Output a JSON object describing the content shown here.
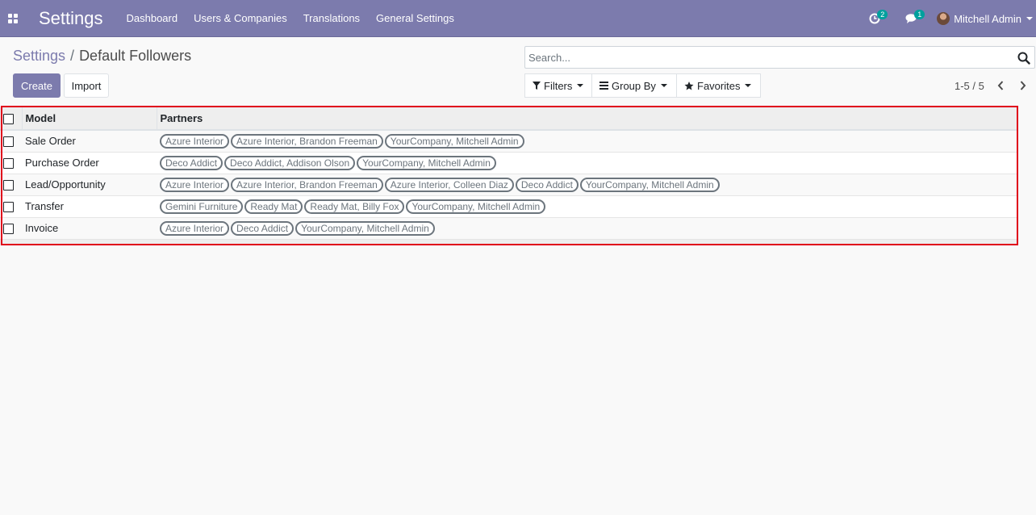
{
  "navbar": {
    "app_title": "Settings",
    "menu": [
      "Dashboard",
      "Users & Companies",
      "Translations",
      "General Settings"
    ],
    "activity_count": "2",
    "messages_count": "1",
    "user_name": "Mitchell Admin"
  },
  "breadcrumb": {
    "parent": "Settings",
    "separator": "/",
    "current": "Default Followers"
  },
  "buttons": {
    "create": "Create",
    "import": "Import"
  },
  "search": {
    "placeholder": "Search..."
  },
  "filters": {
    "filters_label": "Filters",
    "groupby_label": "Group By",
    "favorites_label": "Favorites"
  },
  "pager": {
    "value": "1-5 / 5"
  },
  "table": {
    "columns": [
      "Model",
      "Partners"
    ],
    "rows": [
      {
        "model": "Sale Order",
        "partners": [
          "Azure Interior",
          "Azure Interior, Brandon Freeman",
          "YourCompany, Mitchell Admin"
        ]
      },
      {
        "model": "Purchase Order",
        "partners": [
          "Deco Addict",
          "Deco Addict, Addison Olson",
          "YourCompany, Mitchell Admin"
        ]
      },
      {
        "model": "Lead/Opportunity",
        "partners": [
          "Azure Interior",
          "Azure Interior, Brandon Freeman",
          "Azure Interior, Colleen Diaz",
          "Deco Addict",
          "YourCompany, Mitchell Admin"
        ]
      },
      {
        "model": "Transfer",
        "partners": [
          "Gemini Furniture",
          "Ready Mat",
          "Ready Mat, Billy Fox",
          "YourCompany, Mitchell Admin"
        ]
      },
      {
        "model": "Invoice",
        "partners": [
          "Azure Interior",
          "Deco Addict",
          "YourCompany, Mitchell Admin"
        ]
      }
    ]
  },
  "colors": {
    "brand": "#7c7bad",
    "badge": "#00a09d",
    "highlight": "#e0001b"
  }
}
